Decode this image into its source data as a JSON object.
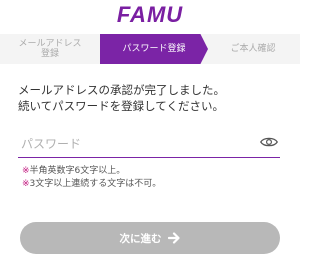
{
  "app": {
    "logo": "FAMU"
  },
  "steps": [
    {
      "label_line1": "メールアドレス",
      "label_line2": "登録"
    },
    {
      "label": "パスワード登録"
    },
    {
      "label": "ご本人確認"
    }
  ],
  "message": {
    "line1": "メールアドレスの承認が完了しました。",
    "line2": "続いてパスワードを登録してください。"
  },
  "password": {
    "placeholder": "パスワード",
    "value": "",
    "toggle_icon": "eye-icon"
  },
  "notes": [
    {
      "mark": "※",
      "text": "半角英数字6文字以上。"
    },
    {
      "mark": "※",
      "text": "3文字以上連続する文字は不可。"
    }
  ],
  "next_button": {
    "label": "次に進む",
    "icon": "arrow-right-icon"
  },
  "colors": {
    "accent": "#7b24a6",
    "note_mark": "#c2187f",
    "disabled_button": "#b8b8b8"
  }
}
